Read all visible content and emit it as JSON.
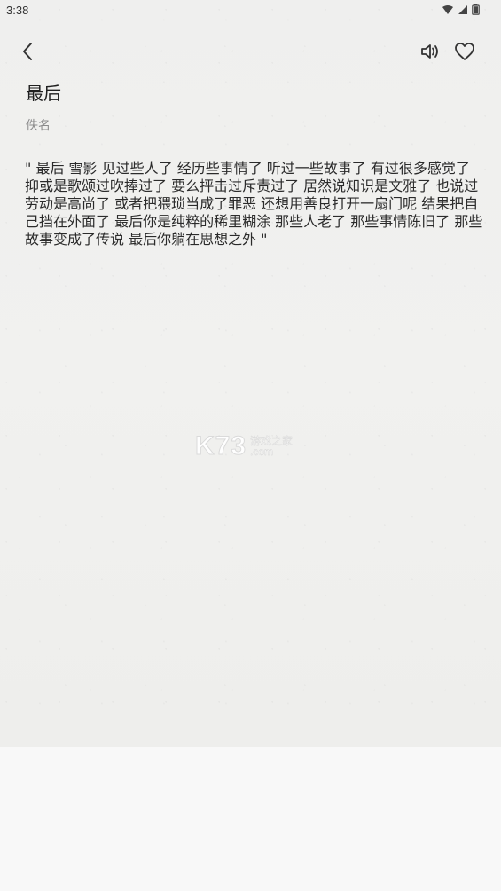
{
  "status_bar": {
    "time": "3:38",
    "icons": [
      "wifi-icon",
      "signal-icon",
      "battery-icon"
    ]
  },
  "header": {
    "back_icon": "chevron-left-icon",
    "audio_icon": "speaker-icon",
    "favorite_icon": "heart-icon"
  },
  "poem": {
    "title": "最后",
    "author": "佚名",
    "body": "\"   最后  雪影  见过些人了  经历些事情了  听过一些故事了  有过很多感觉了  抑或是歌颂过吹捧过了  要么抨击过斥责过了  居然说知识是文雅了  也说过劳动是高尚了  或者把猥琐当成了罪恶  还想用善良打开一扇门呢  结果把自己挡在外面了  最后你是纯粹的稀里糊涂  那些人老了  那些事情陈旧了  那些故事变成了传说  最后你躺在思想之外   \""
  },
  "watermark": {
    "logo": "K73",
    "cn": "游戏之家",
    "en": ".com"
  },
  "colors": {
    "paper": "#efefee",
    "bottom": "#f8f8f8",
    "text": "#2b2b2b",
    "muted": "#8a8a8a"
  }
}
